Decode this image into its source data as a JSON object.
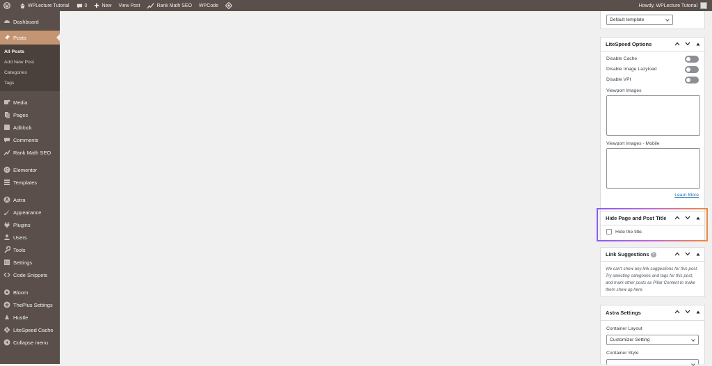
{
  "adminbar": {
    "wp_logo": "wordpress-icon",
    "site_name": "WPLecture Tutorial",
    "comments_count": "0",
    "new_label": "New",
    "view_post_label": "View Post",
    "rank_math_label": "Rank Math SEO",
    "wpcode_label": "WPCode",
    "greeting": "Howdy, WPLecture Tutorial"
  },
  "sidebar": {
    "dashboard": "Dashboard",
    "posts": "Posts",
    "posts_submenu": [
      "All Posts",
      "Add New Post",
      "Categories",
      "Tags"
    ],
    "media": "Media",
    "pages": "Pages",
    "adblock": "Adblock",
    "comments": "Comments",
    "rankmath": "Rank Math SEO",
    "elementor": "Elementor",
    "templates": "Templates",
    "astra": "Astra",
    "appearance": "Appearance",
    "plugins": "Plugins",
    "users": "Users",
    "tools": "Tools",
    "settings": "Settings",
    "code_snippets": "Code Snippets",
    "bloom": "Bloom",
    "theplus": "ThePlus Settings",
    "hustle": "Hustle",
    "litespeed": "LiteSpeed Cache",
    "collapse": "Collapse menu"
  },
  "panel": {
    "template_select": "Default template",
    "litespeed": {
      "title": "LiteSpeed Options",
      "disable_cache": "Disable Cache",
      "disable_lazyload": "Disable Image Lazyload",
      "disable_vpi": "Disable VPI",
      "viewport_images": "Viewport Images",
      "viewport_images_mobile": "Viewport Images - Mobile",
      "learn_more": "Learn More"
    },
    "hide_title": {
      "title": "Hide Page and Post Title",
      "checkbox_label": "Hide the title."
    },
    "link_suggestions": {
      "title": "Link Suggestions",
      "text": "We can't show any link suggestions for this post. Try selecting categories and tags for this post, and mark other posts as Pillar Content to make them show up here."
    },
    "astra": {
      "title": "Astra Settings",
      "container_layout": "Container Layout",
      "container_layout_value": "Customizer Setting",
      "container_style": "Container Style"
    }
  }
}
